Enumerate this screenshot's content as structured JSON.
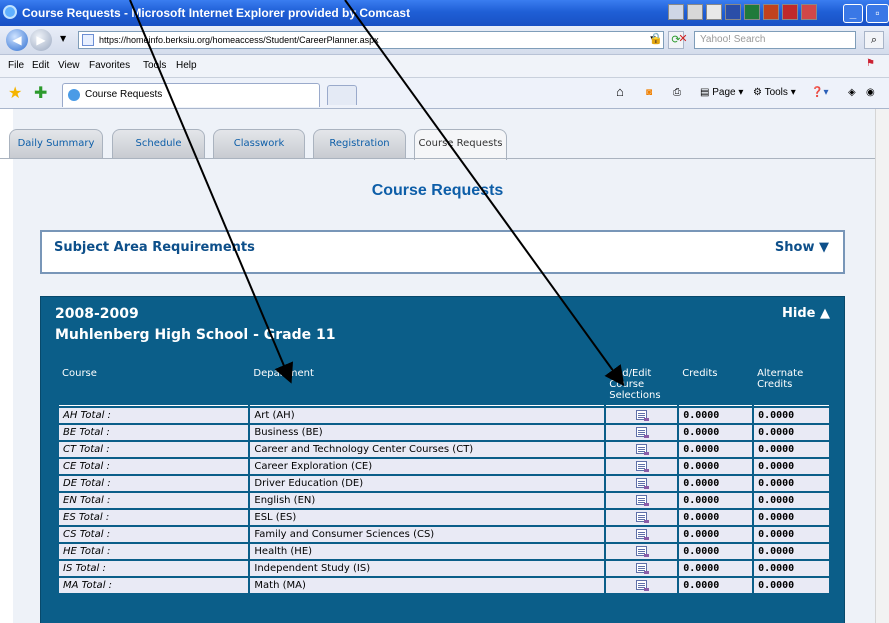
{
  "window": {
    "title": "Course Requests - Microsoft Internet Explorer provided by Comcast",
    "minimize": "_",
    "restore": "▫"
  },
  "address_bar": {
    "url": "https://homeinfo.berksiu.org/homeaccess/Student/CareerPlanner.aspx",
    "search_placeholder": "Yahoo! Search"
  },
  "menu": [
    "File",
    "Edit",
    "View",
    "Favorites",
    "Tools",
    "Help"
  ],
  "browser_tab": {
    "label": "Course Requests"
  },
  "command_bar": {
    "page": "Page",
    "tools": "Tools"
  },
  "app_tabs": [
    "Daily Summary",
    "Schedule",
    "Classwork",
    "Registration",
    "Course Requests"
  ],
  "active_tab": "Course Requests",
  "page_heading": "Course Requests",
  "subject_panel": {
    "title": "Subject Area Requirements",
    "toggle": "Show"
  },
  "year_panel": {
    "year": "2008-2009",
    "school": "Muhlenberg High School - Grade 11",
    "toggle": "Hide"
  },
  "table": {
    "headers": [
      "Course",
      "Department",
      "Add/Edit Course Selections",
      "Credits",
      "Alternate Credits"
    ],
    "rows": [
      {
        "course": "AH Total :",
        "department": "Art (AH)",
        "credits": "0.0000",
        "alt_credits": "0.0000"
      },
      {
        "course": "BE Total :",
        "department": "Business (BE)",
        "credits": "0.0000",
        "alt_credits": "0.0000"
      },
      {
        "course": "CT Total :",
        "department": "Career and Technology Center Courses (CT)",
        "credits": "0.0000",
        "alt_credits": "0.0000"
      },
      {
        "course": "CE Total :",
        "department": "Career Exploration (CE)",
        "credits": "0.0000",
        "alt_credits": "0.0000"
      },
      {
        "course": "DE Total :",
        "department": "Driver Education (DE)",
        "credits": "0.0000",
        "alt_credits": "0.0000"
      },
      {
        "course": "EN Total :",
        "department": "English (EN)",
        "credits": "0.0000",
        "alt_credits": "0.0000"
      },
      {
        "course": "ES Total :",
        "department": "ESL (ES)",
        "credits": "0.0000",
        "alt_credits": "0.0000"
      },
      {
        "course": "CS Total :",
        "department": "Family and Consumer Sciences (CS)",
        "credits": "0.0000",
        "alt_credits": "0.0000"
      },
      {
        "course": "HE Total :",
        "department": "Health (HE)",
        "credits": "0.0000",
        "alt_credits": "0.0000"
      },
      {
        "course": "IS Total :",
        "department": "Independent Study (IS)",
        "credits": "0.0000",
        "alt_credits": "0.0000"
      },
      {
        "course": "MA Total :",
        "department": "Math (MA)",
        "credits": "0.0000",
        "alt_credits": "0.0000"
      }
    ]
  },
  "colors": {
    "panel_blue": "#0b5e89",
    "link_blue": "#0d5ea8",
    "row_bg": "#e9eaf5"
  }
}
